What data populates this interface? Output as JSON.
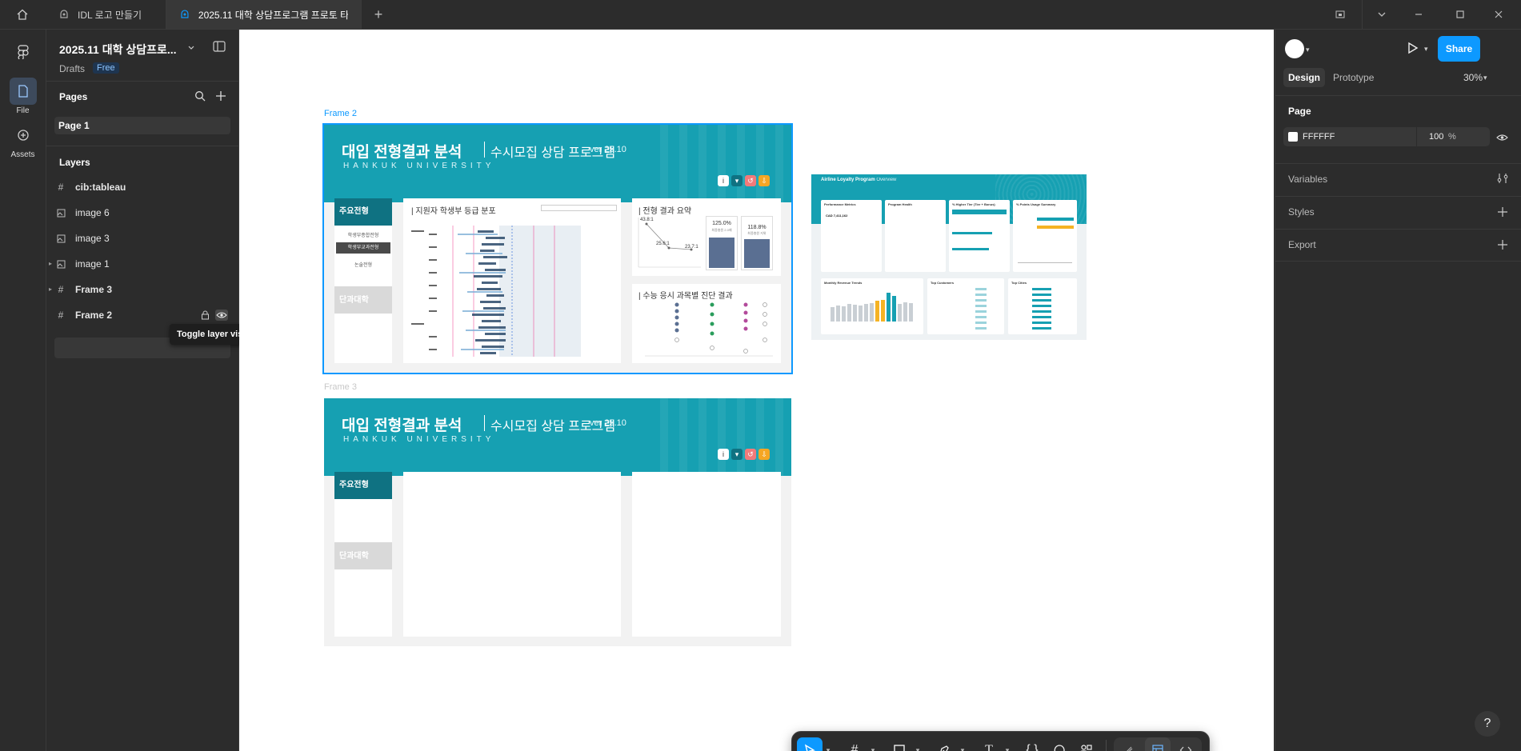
{
  "titlebar": {
    "tabs": [
      {
        "label": "IDL 로고 만들기"
      },
      {
        "label": "2025.11 대학 상담프로그램 프로토 타"
      }
    ]
  },
  "rail": {
    "file_label": "File",
    "assets_label": "Assets"
  },
  "file": {
    "name": "2025.11 대학 상담프로...",
    "location": "Drafts",
    "plan_badge": "Free"
  },
  "pages": {
    "heading": "Pages",
    "items": [
      "Page 1"
    ]
  },
  "layers": {
    "heading": "Layers",
    "items": [
      {
        "name": "cib:tableau",
        "icon": "frame-icon"
      },
      {
        "name": "image 6",
        "icon": "image-icon"
      },
      {
        "name": "image 3",
        "icon": "image-icon"
      },
      {
        "name": "image 1",
        "icon": "image-icon"
      },
      {
        "name": "Frame 3",
        "icon": "frame-icon"
      },
      {
        "name": "Frame 2",
        "icon": "frame-icon"
      }
    ]
  },
  "tooltip": "Toggle layer visibility",
  "canvas": {
    "frame2_label": "Frame 2",
    "frame3_label": "Frame 3",
    "header": {
      "title": "대입 전형결과 분석",
      "subtitle": "수시모집 상담 프로그램",
      "version": "ver 25.10",
      "university": "HANKUK UNIVERSITY"
    },
    "sidebar": {
      "title": "주요전형",
      "items": [
        "학생부종합전형",
        "학생부교과전형",
        "논술전형"
      ],
      "college_label": "단과대학"
    },
    "panels": {
      "grade_dist": "| 지원자 학생부 등급 분포",
      "result_summary": "| 전형 결과 요약",
      "csat_result": "| 수능 응시 과목별 진단 결과"
    },
    "summary": {
      "line_values": [
        "43.8:1",
        "25.6:1",
        "23.7:1"
      ],
      "bar1_value": "125.0%",
      "bar1_caption": "최종충원 2.0배",
      "bar2_value": "118.8%",
      "bar2_caption": "최종충원 지위"
    },
    "airline": {
      "title": "Airline Loyalty Program",
      "subtitle": "Overview",
      "cards": [
        "Performance Metrics",
        "Program Health",
        "% Higher Tier (Tier + Bonus)",
        "% Points Usage Summary"
      ],
      "bottom_cards": [
        "Monthly Revenue Trends",
        "Top Customers",
        "Top Cities"
      ],
      "metric_value": "CAD 7,411,162"
    }
  },
  "rightpanel": {
    "tabs": [
      "Design",
      "Prototype"
    ],
    "zoom": "30%",
    "share_label": "Share",
    "page_heading": "Page",
    "page_color": "FFFFFF",
    "page_opacity": "100",
    "percent": "%",
    "sections": [
      "Variables",
      "Styles",
      "Export"
    ]
  },
  "colors": {
    "accent": "#0d99ff",
    "teal": "#16a0b2",
    "dark_teal": "#0f7282",
    "chrome": "#2c2c2c",
    "selection": "#0d99ff"
  },
  "help_label": "?"
}
